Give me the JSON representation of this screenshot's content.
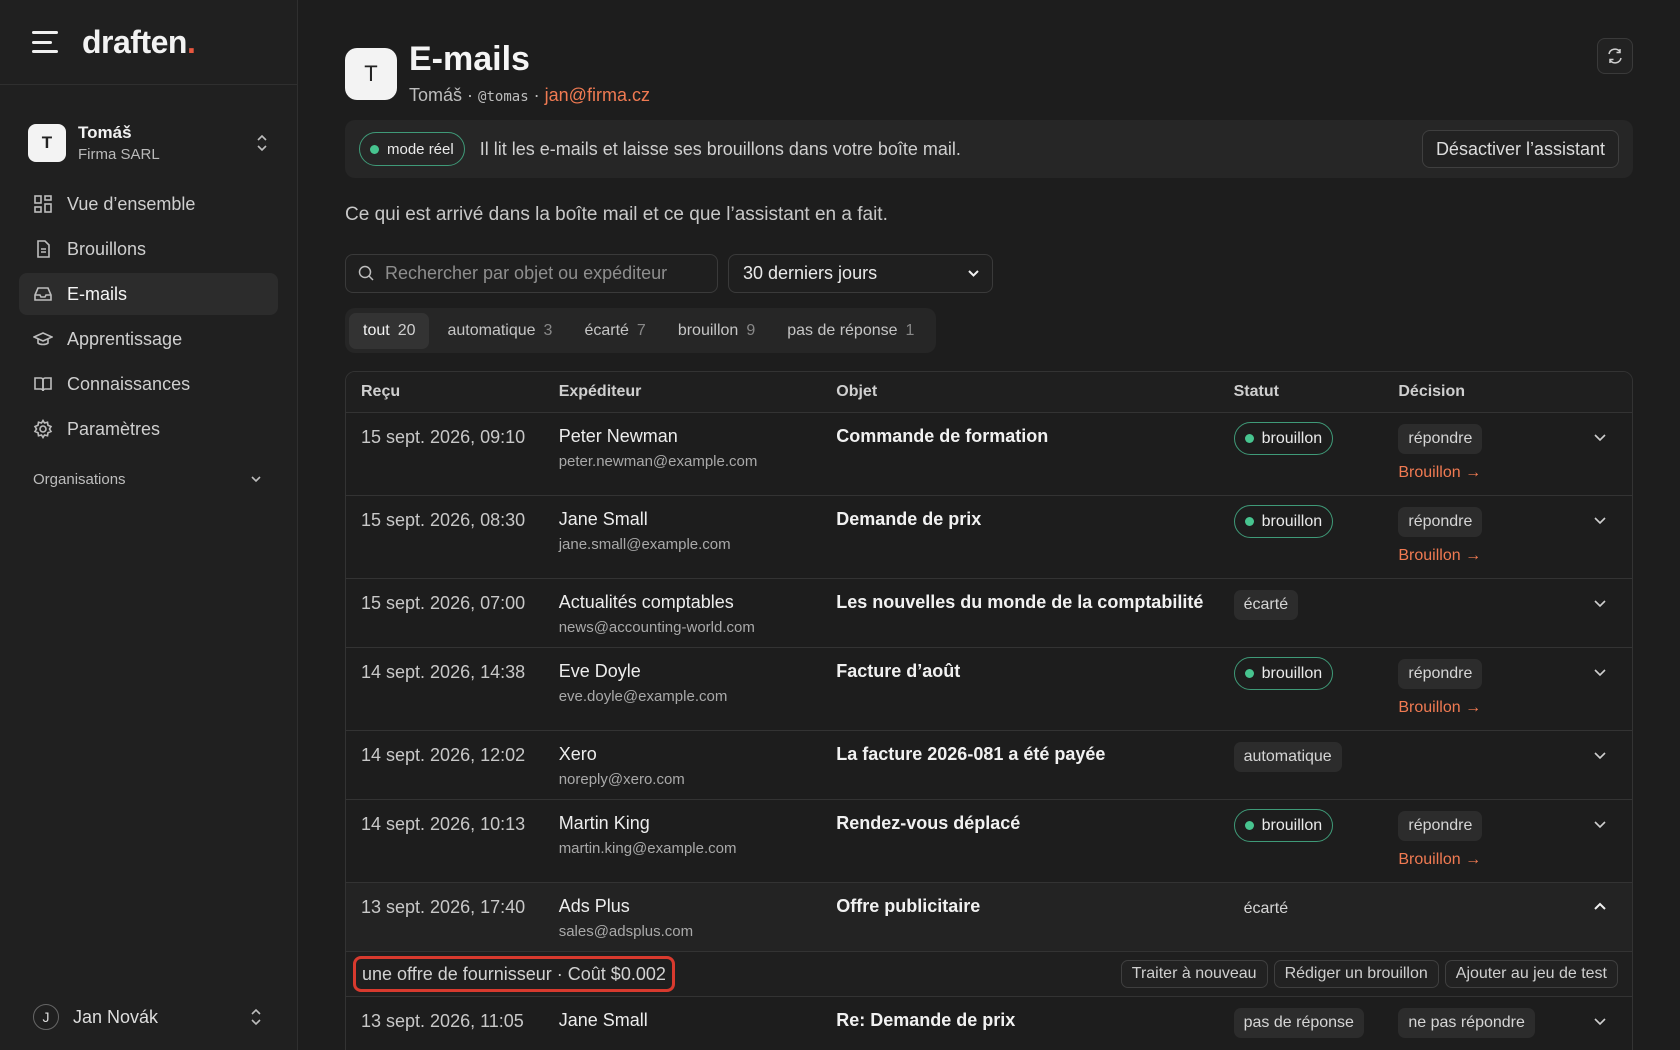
{
  "brand": {
    "name": "draften",
    "dot": "."
  },
  "org": {
    "initial": "T",
    "name": "Tomáš",
    "company": "Firma SARL"
  },
  "nav": [
    {
      "label": "Vue d’ensemble",
      "icon": "grid-icon"
    },
    {
      "label": "Brouillons",
      "icon": "document-icon"
    },
    {
      "label": "E-mails",
      "icon": "inbox-icon",
      "active": true
    },
    {
      "label": "Apprentissage",
      "icon": "graduation-cap-icon"
    },
    {
      "label": "Connaissances",
      "icon": "book-icon"
    },
    {
      "label": "Paramètres",
      "icon": "gear-icon"
    }
  ],
  "nav_section": "Organisations",
  "user": {
    "initial": "J",
    "name": "Jan Novák"
  },
  "header": {
    "initial": "T",
    "title": "E-mails",
    "name": "Tomáš",
    "sep1": "·",
    "handle": "@tomas",
    "sep2": "·",
    "email": "jan@firma.cz"
  },
  "banner": {
    "mode": "mode réel",
    "message": "Il lit les e-mails et laisse ses brouillons dans votre boîte mail.",
    "button": "Désactiver l’assistant"
  },
  "lead": "Ce qui est arrivé dans la boîte mail et ce que l’assistant en a fait.",
  "search": {
    "placeholder": "Rechercher par objet ou expéditeur"
  },
  "period": {
    "selected": "30 derniers jours"
  },
  "tabs": [
    {
      "label": "tout",
      "count": "20",
      "active": true
    },
    {
      "label": "automatique",
      "count": "3"
    },
    {
      "label": "écarté",
      "count": "7"
    },
    {
      "label": "brouillon",
      "count": "9"
    },
    {
      "label": "pas de réponse",
      "count": "1"
    }
  ],
  "table": {
    "headers": [
      "Reçu",
      "Expéditeur",
      "Objet",
      "Statut",
      "Décision"
    ],
    "rows": [
      {
        "received": "15 sept. 2026, 09:10",
        "sender": "Peter Newman",
        "sender_email": "peter.newman@example.com",
        "subject": "Commande de formation",
        "status": "brouillon",
        "decision": "répondre",
        "link": "Brouillon →"
      },
      {
        "received": "15 sept. 2026, 08:30",
        "sender": "Jane Small",
        "sender_email": "jane.small@example.com",
        "subject": "Demande de prix",
        "status": "brouillon",
        "decision": "répondre",
        "link": "Brouillon →"
      },
      {
        "received": "15 sept. 2026, 07:00",
        "sender": "Actualités comptables",
        "sender_email": "news@accounting-world.com",
        "subject": "Les nouvelles du monde de la comptabilité",
        "status": "écarté"
      },
      {
        "received": "14 sept. 2026, 14:38",
        "sender": "Eve Doyle",
        "sender_email": "eve.doyle@example.com",
        "subject": "Facture d’août",
        "status": "brouillon",
        "decision": "répondre",
        "link": "Brouillon →"
      },
      {
        "received": "14 sept. 2026, 12:02",
        "sender": "Xero",
        "sender_email": "noreply@xero.com",
        "subject": "La facture 2026-081 a été payée",
        "status": "automatique"
      },
      {
        "received": "14 sept. 2026, 10:13",
        "sender": "Martin King",
        "sender_email": "martin.king@example.com",
        "subject": "Rendez-vous déplacé",
        "status": "brouillon",
        "decision": "répondre",
        "link": "Brouillon →"
      },
      {
        "received": "13 sept. 2026, 17:40",
        "sender": "Ads Plus",
        "sender_email": "sales@adsplus.com",
        "subject": "Offre publicitaire",
        "status": "écarté"
      },
      {
        "received": "13 sept. 2026, 11:05",
        "sender": "Jane Small",
        "sender_email": "",
        "subject": "Re: Demande de prix",
        "status": "pas de réponse",
        "decision": "ne pas répondre"
      }
    ],
    "detail": {
      "note": "une offre de fournisseur · Coût $0.002",
      "actions": [
        "Traiter à nouveau",
        "Rédiger un brouillon",
        "Ajouter au jeu de test"
      ]
    }
  },
  "colors": {
    "accent": "#f07a52",
    "success": "#47c48f",
    "highlight": "#d83a2e"
  }
}
